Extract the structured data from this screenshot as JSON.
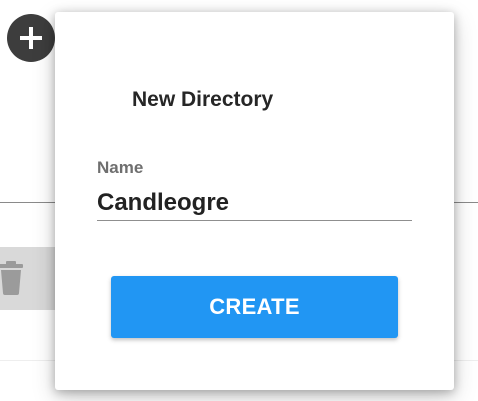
{
  "dialog": {
    "title": "New Directory",
    "name_field": {
      "label": "Name",
      "value": "Candleogre"
    },
    "create_label": "CREATE"
  },
  "background": {
    "fab_icon": "plus-icon",
    "delete_icon": "trash-icon"
  },
  "colors": {
    "accent": "#2196f3",
    "fab": "#3d3d3d"
  }
}
